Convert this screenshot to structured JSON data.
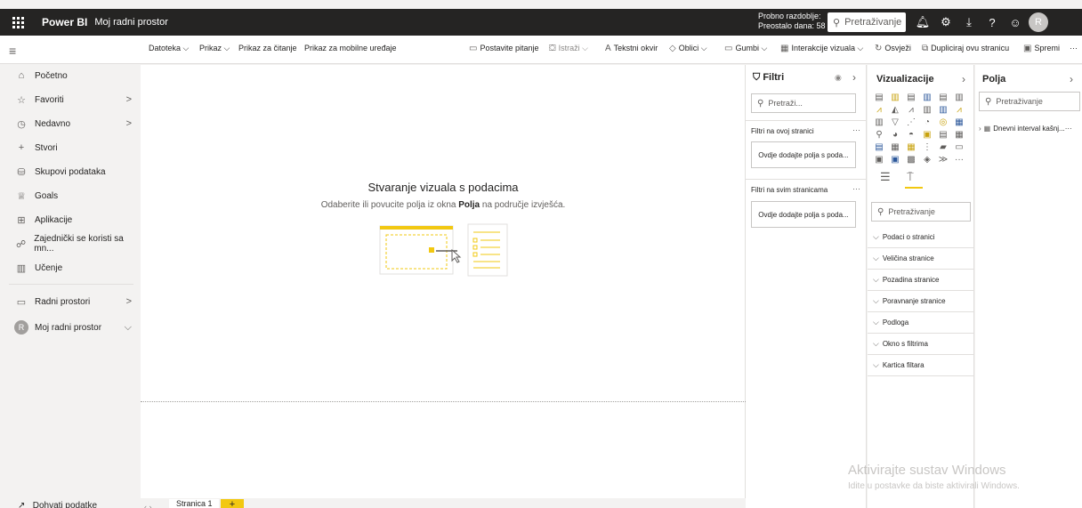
{
  "topbar": {
    "app_name": "Power BI",
    "workspace": "Moj radni prostor",
    "trial_line1": "Probno razdoblje:",
    "trial_line2": "Preostalo dana: 58",
    "search_placeholder": "Pretraživanje",
    "icons": [
      "bell-icon",
      "gear-icon",
      "download-icon",
      "help-icon",
      "smiley-icon"
    ],
    "avatar": "R"
  },
  "ribbon": {
    "left_items": [
      "Datoteka ⌵",
      "Prikaz ⌵",
      "Prikaz za čitanje",
      "Prikaz za mobilne uređaje"
    ],
    "right_items": [
      {
        "icon": "💬",
        "label": "Postavite pitanje"
      },
      {
        "icon": "⛋",
        "label": "Istraži ⌵"
      },
      {
        "icon": "A",
        "label": "Tekstni okvir"
      },
      {
        "icon": "◇",
        "label": "Oblici ⌵"
      },
      {
        "icon": "▭",
        "label": "Gumbi ⌵"
      },
      {
        "icon": "▦",
        "label": "Interakcije vizuala ⌵"
      },
      {
        "icon": "↻",
        "label": "Osvježi"
      },
      {
        "icon": "⧉",
        "label": "Dupliciraj ovu stranicu"
      },
      {
        "icon": "💾",
        "label": "Spremi"
      },
      {
        "icon": "",
        "label": "···"
      }
    ]
  },
  "nav": {
    "items": [
      {
        "icon": "⌂",
        "label": "Početno",
        "chevron": ""
      },
      {
        "icon": "☆",
        "label": "Favoriti",
        "chevron": ">"
      },
      {
        "icon": "◷",
        "label": "Nedavno",
        "chevron": ">"
      },
      {
        "icon": "+",
        "label": "Stvori",
        "chevron": ""
      },
      {
        "icon": "⛁",
        "label": "Skupovi podataka",
        "chevron": ""
      },
      {
        "icon": "♕",
        "label": "Goals",
        "chevron": ""
      },
      {
        "icon": "⊞",
        "label": "Aplikacije",
        "chevron": ""
      },
      {
        "icon": "☍",
        "label": "Zajednički se koristi sa mn...",
        "chevron": ""
      },
      {
        "icon": "▥",
        "label": "Učenje",
        "chevron": ""
      }
    ],
    "workspaces": {
      "icon": "▭",
      "label": "Radni prostori",
      "chevron": ">"
    },
    "my_workspace": {
      "avatar": "R",
      "label": "Moj radni prostor",
      "chevron": "⌵"
    },
    "get_data": {
      "icon": "↗",
      "label": "Dohvati podatke"
    }
  },
  "canvas": {
    "title": "Stvaranje vizuala s podacima",
    "subtitle_before": "Odaberite ili povucite polja iz okna ",
    "subtitle_bold": "Polja",
    "subtitle_after": " na područje izvješća."
  },
  "tabs": {
    "nav_arrows": "‹ ›",
    "page": "Stranica 1",
    "add": "+"
  },
  "filters": {
    "title": "Filtri",
    "search": "Pretraži...",
    "page_label": "Filtri na ovoj stranici",
    "all_label": "Filtri na svim stranicama",
    "drop_text": "Ovdje dodajte polja s poda..."
  },
  "visualizations": {
    "title": "Vizualizacije",
    "search": "Pretraživanje",
    "icons": [
      "▤",
      "▥",
      "▤",
      "▥",
      "▤",
      "▥",
      "⩘",
      "◭",
      "⩘",
      "▥",
      "▥",
      "⩘",
      "▥",
      "▽",
      "⋰",
      "◔",
      "◎",
      "▦",
      "⚲",
      "◕",
      "◓",
      "▣",
      "▤",
      "▦",
      "▤",
      "▦",
      "▦",
      "⋮",
      "▰",
      "▭",
      "▣",
      "▣",
      "▩",
      "◈",
      "≫",
      "···"
    ],
    "sections": [
      "Podaci o stranici",
      "Veličina stranice",
      "Pozadina stranice",
      "Poravnanje stranice",
      "Podloga",
      "Okno s filtrima",
      "Kartica filtara"
    ]
  },
  "fields": {
    "title": "Polja",
    "search": "Pretraživanje",
    "table": "Dnevni interval kašnj...",
    "more": "···"
  },
  "watermark": {
    "line1": "Aktivirajte sustav Windows",
    "line2": "Idite u postavke da biste aktivirali Windows."
  },
  "colors": {
    "topbar": "#252423",
    "accent": "#f2c811",
    "pane_bg": "#ffffff",
    "nav_bg": "#f3f2f1"
  }
}
